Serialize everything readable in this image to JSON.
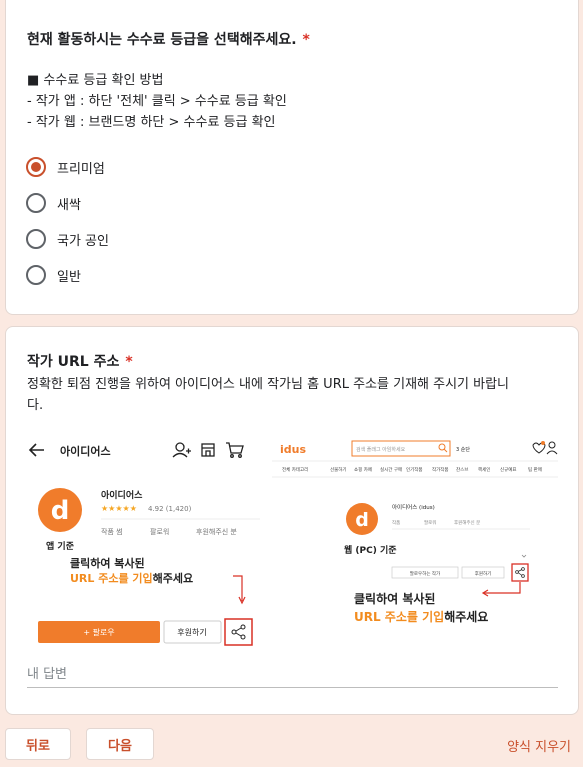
{
  "q1": {
    "title": "현재 활동하시는 수수료 등급을 선택해주세요.",
    "required_mark": "*",
    "desc_lines": [
      "■ 수수료 등급 확인 방법",
      "- 작가 앱 : 하단 '전체' 클릭 > 수수료 등급 확인",
      "- 작가 웹 : 브랜드명 하단 > 수수료 등급 확인"
    ],
    "options": [
      {
        "label": "프리미엄",
        "selected": true
      },
      {
        "label": "새싹",
        "selected": false
      },
      {
        "label": "국가 공인",
        "selected": false
      },
      {
        "label": "일반",
        "selected": false
      }
    ]
  },
  "q2": {
    "title": "작가 URL 주소",
    "required_mark": "*",
    "desc_lines": [
      "정확한 퇴점 진행을 위하여 아이디어스 내에 작가님 홈 URL 주소를 기재해 주시기 바랍니",
      "다."
    ],
    "answer_placeholder": "내 답변",
    "answer_value": ""
  },
  "guide": {
    "app": {
      "header_title": "아이디어스",
      "brand_name": "아이디어스",
      "stars": "★★★★★",
      "rating": "4.92 (1,420)",
      "stats": [
        "작품 썸",
        "팔로워",
        "후원해주신 분"
      ],
      "basis_label": "앱 기준",
      "callout_line1": "클릭하여 복사된",
      "callout_line2_highlight": "URL 주소를 기입",
      "callout_line2_rest": "해주세요",
      "follow_button": "+ 팔로우",
      "support_button": "후원하기"
    },
    "web": {
      "logo": "idus",
      "search_placeholder": "검색 플래그 아임하세요",
      "menu": [
        "전체 카테고리",
        "선물하기",
        "쇼핑 카페",
        "실시간 구매",
        "인기작품",
        "작가작품",
        "찬스브",
        "핵세인",
        "신규예표",
        "팀 판매"
      ],
      "brand_name": "아이디어스 (idus)",
      "stats": [
        "작품",
        "팔로워",
        "후원해주신 분"
      ],
      "basis_label": "웹 (PC) 기준",
      "follow_button": "팔로우하는 작가",
      "support_button": "후원하기",
      "callout_line1": "클릭하여 복사된",
      "callout_line2_highlight": "URL 주소를 기입",
      "callout_line2_rest": "해주세요"
    },
    "accent_orange": "#f07c2b",
    "highlight_orange": "#f28c1f",
    "callout_red": "#d93025"
  },
  "nav": {
    "back_label": "뒤로",
    "next_label": "다음",
    "clear_label": "양식 지우기"
  },
  "colors": {
    "background": "#fbe9e1",
    "accent": "#c9502c",
    "required": "#d93025"
  }
}
